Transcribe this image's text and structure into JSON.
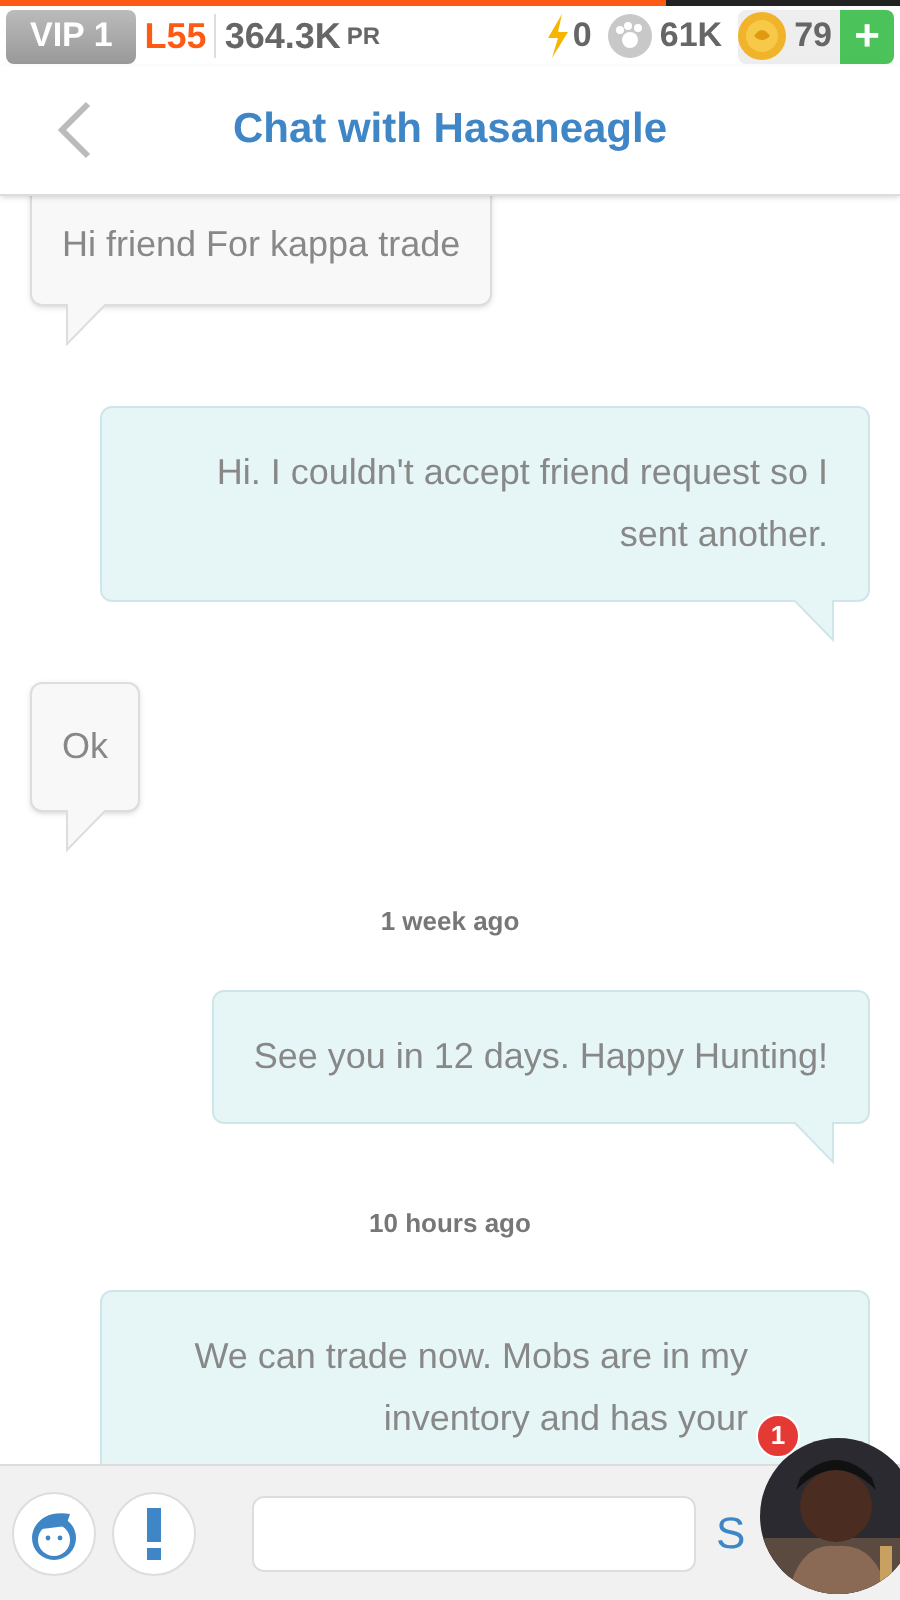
{
  "status_bar": {
    "xp_bar": {
      "level": 0.74
    },
    "vip": "VIP 1",
    "level_label": "L55",
    "power": "364.3K",
    "power_unit": "PR",
    "energy": "0",
    "food": "61K",
    "coins": "79",
    "add": "+"
  },
  "header": {
    "title": "Chat with Hasaneagle"
  },
  "messages": [
    {
      "kind": "incoming",
      "text": "Hi friend For kappa trade"
    },
    {
      "kind": "outgoing",
      "text": "Hi. I couldn't accept friend request so I sent another."
    },
    {
      "kind": "incoming",
      "text": "Ok"
    },
    {
      "kind": "timestamp",
      "text": "1 week ago"
    },
    {
      "kind": "outgoing",
      "text": "See you in 12 days. Happy Hunting!"
    },
    {
      "kind": "timestamp",
      "text": "10 hours ago"
    },
    {
      "kind": "outgoing",
      "text": "We can trade now. Mobs are in my inventory and has your"
    }
  ],
  "composer": {
    "send": "S"
  },
  "chat_head": {
    "badge": "1"
  }
}
